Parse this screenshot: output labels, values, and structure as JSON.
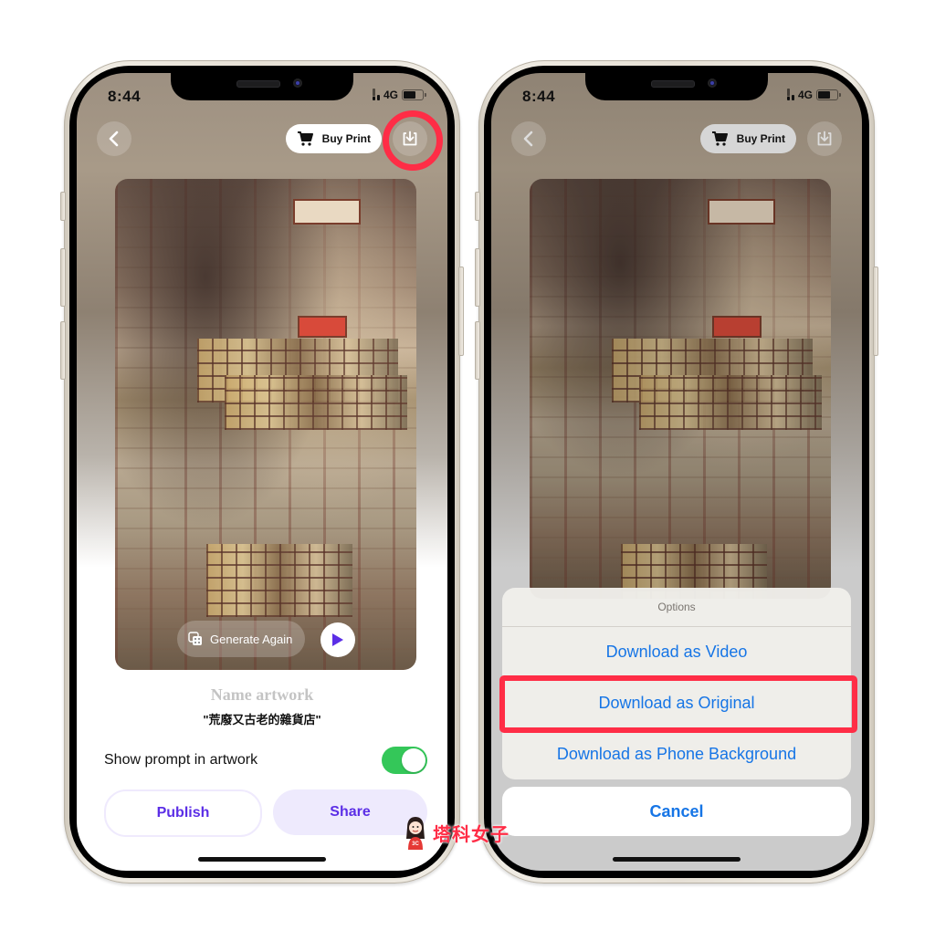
{
  "status_bar": {
    "time": "8:44",
    "network": "4G"
  },
  "top_bar": {
    "buy_print_label": "Buy Print",
    "back_icon": "chevron-left-icon",
    "download_icon": "download-icon",
    "cart_icon": "cart-icon"
  },
  "artwork": {
    "generate_again_label": "Generate Again",
    "play_icon": "play-icon",
    "dice_icon": "dice-icon"
  },
  "details": {
    "name_placeholder": "Name artwork",
    "prompt": "\"荒廢又古老的雜貨店\"",
    "toggle_label": "Show prompt in artwork",
    "toggle_on": true
  },
  "actions": {
    "publish_label": "Publish",
    "share_label": "Share"
  },
  "action_sheet": {
    "title": "Options",
    "items": [
      {
        "label": "Download as Video"
      },
      {
        "label": "Download as Original",
        "highlighted": true
      },
      {
        "label": "Download as Phone Background"
      }
    ],
    "cancel_label": "Cancel"
  },
  "watermark": {
    "text": "塔科女子",
    "badge": "3C"
  },
  "colors": {
    "accent_purple": "#5b2ee6",
    "ios_blue": "#1675e6",
    "highlight_red": "#ff2d46",
    "toggle_green": "#34c759"
  }
}
